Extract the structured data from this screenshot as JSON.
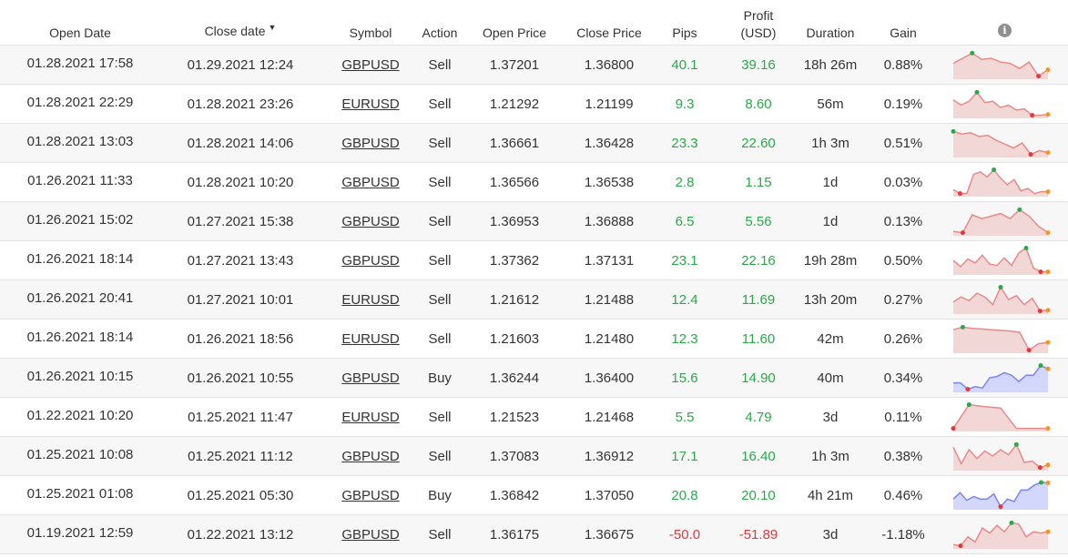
{
  "header": {
    "open_date": "Open Date",
    "close_date": "Close date",
    "sort_arrow": "▼",
    "symbol": "Symbol",
    "action": "Action",
    "open_price": "Open Price",
    "close_price": "Close Price",
    "pips": "Pips",
    "profit_line1": "Profit",
    "profit_line2": "(USD)",
    "duration": "Duration",
    "gain": "Gain",
    "info_icon": "info-icon"
  },
  "colors": {
    "positive": "#2ba84a",
    "negative": "#e5383b",
    "sell_line": "#e88a8a",
    "sell_fill": "#f2d7d7",
    "buy_line": "#7a86f0",
    "buy_fill": "#d3d7fb",
    "marker_high": "#2ba84a",
    "marker_low": "#e5383b",
    "marker_end": "#f7931e"
  },
  "trades": [
    {
      "open_date": "01.28.2021 17:58",
      "close_date": "01.29.2021 12:24",
      "symbol": "GBPUSD",
      "action": "Sell",
      "open_price": "1.37201",
      "close_price": "1.36800",
      "pips": "40.1",
      "profit": "39.16",
      "duration": "18h 26m",
      "gain": "0.88%",
      "positive": true,
      "spark": [
        0.55,
        0.75,
        0.95,
        0.7,
        0.75,
        0.6,
        0.55,
        0.35,
        0.6,
        0.05,
        0.3
      ]
    },
    {
      "open_date": "01.28.2021 22:29",
      "close_date": "01.28.2021 23:26",
      "symbol": "EURUSD",
      "action": "Sell",
      "open_price": "1.21292",
      "close_price": "1.21199",
      "pips": "9.3",
      "profit": "8.60",
      "duration": "56m",
      "gain": "0.19%",
      "positive": true,
      "spark": [
        0.65,
        0.45,
        0.6,
        0.95,
        0.55,
        0.6,
        0.35,
        0.45,
        0.25,
        0.3,
        0.05,
        0.05,
        0.08
      ]
    },
    {
      "open_date": "01.28.2021 13:03",
      "close_date": "01.28.2021 14:06",
      "symbol": "GBPUSD",
      "action": "Sell",
      "open_price": "1.36661",
      "close_price": "1.36428",
      "pips": "23.3",
      "profit": "22.60",
      "duration": "1h 3m",
      "gain": "0.51%",
      "positive": true,
      "spark": [
        0.95,
        0.85,
        0.9,
        0.75,
        0.8,
        0.6,
        0.45,
        0.3,
        0.5,
        0.05,
        0.2,
        0.12
      ]
    },
    {
      "open_date": "01.26.2021 11:33",
      "close_date": "01.28.2021 10:20",
      "symbol": "GBPUSD",
      "action": "Sell",
      "open_price": "1.36566",
      "close_price": "1.36538",
      "pips": "2.8",
      "profit": "1.15",
      "duration": "1d",
      "gain": "0.03%",
      "positive": true,
      "spark": [
        0.2,
        0.05,
        0.05,
        0.8,
        0.9,
        0.7,
        0.98,
        0.65,
        0.4,
        0.6,
        0.15,
        0.25,
        0.05,
        0.12,
        0.12
      ]
    },
    {
      "open_date": "01.26.2021 15:02",
      "close_date": "01.27.2021 15:38",
      "symbol": "GBPUSD",
      "action": "Sell",
      "open_price": "1.36953",
      "close_price": "1.36888",
      "pips": "6.5",
      "profit": "5.56",
      "duration": "1d",
      "gain": "0.13%",
      "positive": true,
      "spark": [
        0.1,
        0.05,
        0.75,
        0.6,
        0.7,
        0.8,
        0.6,
        0.95,
        0.7,
        0.3,
        0.05
      ]
    },
    {
      "open_date": "01.26.2021 18:14",
      "close_date": "01.27.2021 13:43",
      "symbol": "GBPUSD",
      "action": "Sell",
      "open_price": "1.37362",
      "close_price": "1.37131",
      "pips": "23.1",
      "profit": "22.16",
      "duration": "19h 28m",
      "gain": "0.50%",
      "positive": true,
      "spark": [
        0.5,
        0.25,
        0.55,
        0.4,
        0.7,
        0.35,
        0.3,
        0.6,
        0.3,
        0.8,
        0.98,
        0.2,
        0.05,
        0.05
      ]
    },
    {
      "open_date": "01.26.2021 20:41",
      "close_date": "01.27.2021 10:01",
      "symbol": "EURUSD",
      "action": "Sell",
      "open_price": "1.21612",
      "close_price": "1.21488",
      "pips": "12.4",
      "profit": "11.69",
      "duration": "13h 20m",
      "gain": "0.27%",
      "positive": true,
      "spark": [
        0.4,
        0.6,
        0.45,
        0.75,
        0.6,
        0.3,
        0.98,
        0.5,
        0.65,
        0.3,
        0.55,
        0.05,
        0.08
      ]
    },
    {
      "open_date": "01.26.2021 18:14",
      "close_date": "01.26.2021 18:56",
      "symbol": "EURUSD",
      "action": "Sell",
      "open_price": "1.21603",
      "close_price": "1.21480",
      "pips": "12.3",
      "profit": "11.60",
      "duration": "42m",
      "gain": "0.26%",
      "positive": true,
      "spark": [
        0.85,
        0.95,
        0.9,
        0.88,
        0.85,
        0.82,
        0.8,
        0.75,
        0.05,
        0.3,
        0.35
      ]
    },
    {
      "open_date": "01.26.2021 10:15",
      "close_date": "01.26.2021 10:55",
      "symbol": "GBPUSD",
      "action": "Buy",
      "open_price": "1.36244",
      "close_price": "1.36400",
      "pips": "15.6",
      "profit": "14.90",
      "duration": "40m",
      "gain": "0.34%",
      "positive": true,
      "spark": [
        0.3,
        0.3,
        0.05,
        0.15,
        0.1,
        0.5,
        0.55,
        0.7,
        0.6,
        0.35,
        0.6,
        0.6,
        0.98,
        0.85
      ]
    },
    {
      "open_date": "01.22.2021 10:20",
      "close_date": "01.25.2021 11:47",
      "symbol": "EURUSD",
      "action": "Sell",
      "open_price": "1.21523",
      "close_price": "1.21468",
      "pips": "5.5",
      "profit": "4.79",
      "duration": "3d",
      "gain": "0.11%",
      "positive": true,
      "spark": [
        0.05,
        0.98,
        0.9,
        0.85,
        0.05,
        0.05,
        0.05
      ]
    },
    {
      "open_date": "01.25.2021 10:08",
      "close_date": "01.25.2021 11:12",
      "symbol": "GBPUSD",
      "action": "Sell",
      "open_price": "1.37083",
      "close_price": "1.36912",
      "pips": "17.1",
      "profit": "16.40",
      "duration": "1h 3m",
      "gain": "0.38%",
      "positive": true,
      "spark": [
        0.85,
        0.2,
        0.75,
        0.4,
        0.7,
        0.5,
        0.75,
        0.55,
        0.95,
        0.25,
        0.3,
        0.05,
        0.15
      ]
    },
    {
      "open_date": "01.25.2021 01:08",
      "close_date": "01.25.2021 05:30",
      "symbol": "GBPUSD",
      "action": "Buy",
      "open_price": "1.36842",
      "close_price": "1.37050",
      "pips": "20.8",
      "profit": "20.10",
      "duration": "4h 21m",
      "gain": "0.46%",
      "positive": true,
      "spark": [
        0.35,
        0.6,
        0.3,
        0.45,
        0.35,
        0.35,
        0.55,
        0.05,
        0.35,
        0.25,
        0.7,
        0.7,
        0.9,
        1.0,
        0.98
      ]
    },
    {
      "open_date": "01.19.2021 12:59",
      "close_date": "01.22.2021 13:12",
      "symbol": "GBPUSD",
      "action": "Sell",
      "open_price": "1.36175",
      "close_price": "1.36675",
      "pips": "-50.0",
      "profit": "-51.89",
      "duration": "3d",
      "gain": "-1.18%",
      "positive": false,
      "spark": [
        0.1,
        0.05,
        0.4,
        0.2,
        0.75,
        0.55,
        0.85,
        0.6,
        0.95,
        0.9,
        0.4,
        0.6,
        0.55,
        0.6
      ]
    }
  ]
}
